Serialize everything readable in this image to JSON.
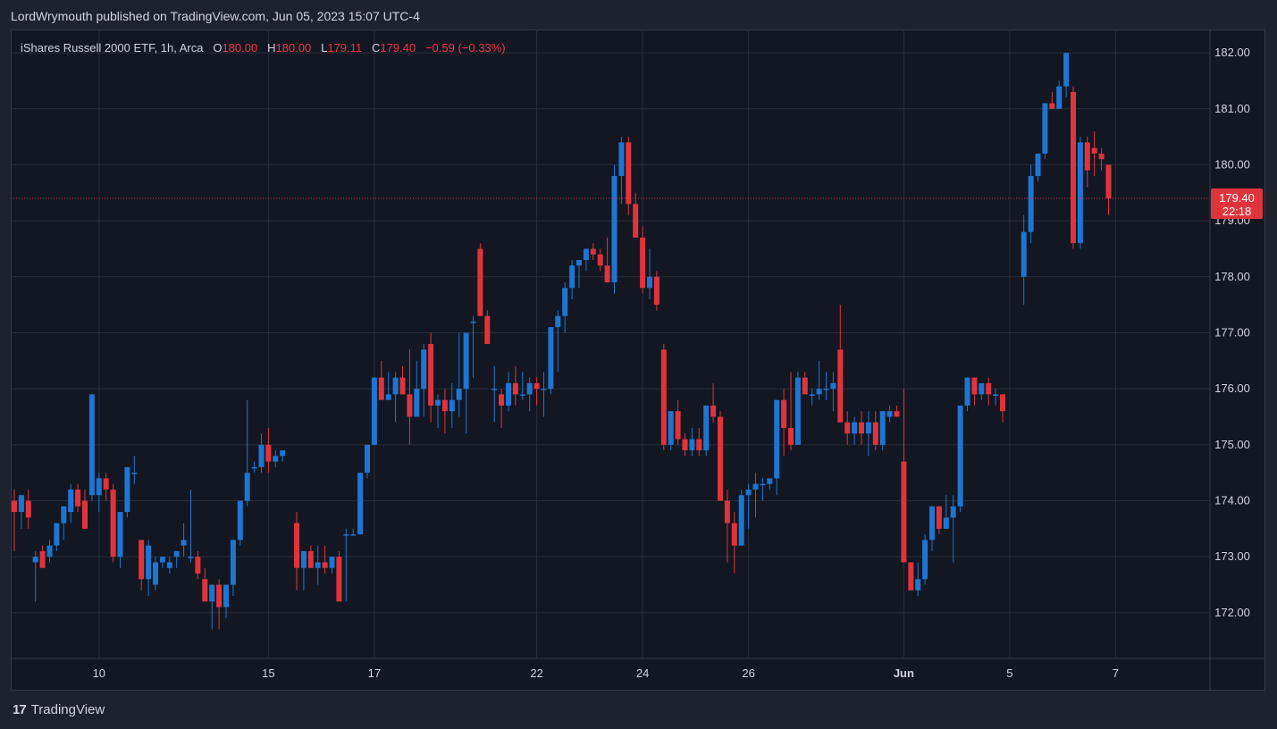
{
  "header": {
    "published_line": "LordWrymouth published on TradingView.com, Jun 05, 2023 15:07 UTC-4"
  },
  "legend": {
    "instrument": "iShares Russell 2000 ETF, 1h, Arca",
    "open_label": "O",
    "open": "180.00",
    "high_label": "H",
    "high": "180.00",
    "low_label": "L",
    "low": "179.11",
    "close_label": "C",
    "close": "179.40",
    "change": "−0.59 (−0.33%)"
  },
  "price_tag": {
    "price": "179.40",
    "countdown": "22:18"
  },
  "footer": {
    "logo_mark": "17",
    "brand": "TradingView"
  },
  "colors": {
    "up": "#2962ff",
    "up_draw": "#1e76d2",
    "down": "#e0343c",
    "background": "#1e222d",
    "pane": "#131722",
    "grid": "#2a2e39",
    "text": "#d1d4dc"
  },
  "chart_data": {
    "type": "candlestick",
    "title": "iShares Russell 2000 ETF, 1h, Arca",
    "ylim": [
      171.2,
      182.4
    ],
    "y_ticks": [
      172,
      173,
      174,
      175,
      176,
      177,
      178,
      179,
      180,
      181,
      182
    ],
    "x_ticks": [
      {
        "label": "10",
        "index": 12
      },
      {
        "label": "15",
        "index": 36
      },
      {
        "label": "17",
        "index": 51
      },
      {
        "label": "22",
        "index": 74
      },
      {
        "label": "24",
        "index": 89
      },
      {
        "label": "26",
        "index": 104
      },
      {
        "label": "Jun",
        "index": 126,
        "bold": true
      },
      {
        "label": "5",
        "index": 141
      },
      {
        "label": "7",
        "index": 156
      }
    ],
    "last_price": 179.4,
    "candles": [
      [
        174.0,
        174.2,
        173.1,
        173.8
      ],
      [
        173.8,
        174.1,
        173.5,
        174.1
      ],
      [
        174.0,
        174.2,
        173.5,
        173.7
      ],
      [
        172.9,
        173.1,
        172.2,
        173.0
      ],
      [
        173.1,
        173.2,
        172.8,
        172.8
      ],
      [
        173.0,
        173.3,
        172.9,
        173.2
      ],
      [
        173.2,
        173.6,
        173.1,
        173.6
      ],
      [
        173.6,
        173.9,
        173.3,
        173.9
      ],
      [
        173.8,
        174.3,
        173.6,
        174.2
      ],
      [
        174.2,
        174.3,
        173.8,
        173.9
      ],
      [
        174.0,
        174.2,
        173.5,
        173.5
      ],
      [
        174.1,
        175.9,
        174.0,
        175.9
      ],
      [
        174.1,
        174.5,
        173.8,
        174.4
      ],
      [
        174.4,
        174.5,
        174.0,
        174.2
      ],
      [
        174.2,
        174.3,
        172.9,
        173.0
      ],
      [
        173.0,
        173.8,
        172.8,
        173.8
      ],
      [
        173.8,
        174.6,
        173.7,
        174.6
      ],
      [
        174.5,
        174.8,
        174.3,
        174.5
      ],
      [
        173.3,
        173.3,
        172.4,
        172.6
      ],
      [
        172.6,
        173.3,
        172.3,
        173.2
      ],
      [
        172.5,
        173.0,
        172.4,
        172.9
      ],
      [
        172.9,
        173.0,
        172.8,
        173.0
      ],
      [
        172.8,
        173.0,
        172.7,
        172.9
      ],
      [
        173.0,
        173.1,
        172.8,
        173.1
      ],
      [
        173.2,
        173.6,
        173.0,
        173.3
      ],
      [
        173.0,
        174.2,
        172.9,
        173.0
      ],
      [
        173.0,
        173.1,
        172.6,
        172.7
      ],
      [
        172.6,
        172.8,
        172.2,
        172.2
      ],
      [
        172.2,
        172.5,
        171.7,
        172.5
      ],
      [
        172.5,
        172.6,
        171.7,
        172.1
      ],
      [
        172.1,
        172.5,
        171.9,
        172.5
      ],
      [
        172.5,
        173.3,
        172.3,
        173.3
      ],
      [
        173.3,
        174.0,
        173.2,
        174.0
      ],
      [
        174.0,
        175.8,
        173.9,
        174.5
      ],
      [
        174.6,
        174.7,
        174.5,
        174.6
      ],
      [
        174.6,
        175.2,
        174.5,
        175.0
      ],
      [
        175.0,
        175.3,
        174.5,
        174.7
      ],
      [
        174.7,
        174.9,
        174.6,
        174.8
      ],
      [
        174.8,
        174.9,
        174.7,
        174.9
      ],
      [
        null,
        null,
        null,
        null
      ],
      [
        173.6,
        173.8,
        172.4,
        172.8
      ],
      [
        172.8,
        173.1,
        172.4,
        173.1
      ],
      [
        173.1,
        173.2,
        172.8,
        172.8
      ],
      [
        172.8,
        173.2,
        172.5,
        172.9
      ],
      [
        172.9,
        173.2,
        172.7,
        172.8
      ],
      [
        172.8,
        172.9,
        172.7,
        173.0
      ],
      [
        173.0,
        173.1,
        172.2,
        172.2
      ],
      [
        173.4,
        173.5,
        172.2,
        173.4
      ],
      [
        173.4,
        173.5,
        173.4,
        173.4
      ],
      [
        173.4,
        174.5,
        173.4,
        174.5
      ],
      [
        174.5,
        174.9,
        174.4,
        175.0
      ],
      [
        175.0,
        176.2,
        175.0,
        176.2
      ],
      [
        176.2,
        176.5,
        175.8,
        175.8
      ],
      [
        175.8,
        176.3,
        175.9,
        175.9
      ],
      [
        175.9,
        176.3,
        175.4,
        176.2
      ],
      [
        176.2,
        176.4,
        175.9,
        175.9
      ],
      [
        175.9,
        176.7,
        175.0,
        175.5
      ],
      [
        175.5,
        176.5,
        175.5,
        176.0
      ],
      [
        176.0,
        176.8,
        175.5,
        176.7
      ],
      [
        176.8,
        177.0,
        175.4,
        175.7
      ],
      [
        175.7,
        175.9,
        175.3,
        175.8
      ],
      [
        175.8,
        176.0,
        175.2,
        175.6
      ],
      [
        175.6,
        176.1,
        175.3,
        175.8
      ],
      [
        175.8,
        177.0,
        175.5,
        176.0
      ],
      [
        176.0,
        177.0,
        175.2,
        177.0
      ],
      [
        177.2,
        177.3,
        176.2,
        177.2
      ],
      [
        178.5,
        178.6,
        177.3,
        177.3
      ],
      [
        177.3,
        177.4,
        176.8,
        176.8
      ],
      [
        176.0,
        176.4,
        175.4,
        176.0
      ],
      [
        175.9,
        176.0,
        175.3,
        175.7
      ],
      [
        175.7,
        176.3,
        175.6,
        176.1
      ],
      [
        176.1,
        176.4,
        175.7,
        175.9
      ],
      [
        175.9,
        176.3,
        175.8,
        175.9
      ],
      [
        175.9,
        176.2,
        175.6,
        176.1
      ],
      [
        176.1,
        176.2,
        175.7,
        176.0
      ],
      [
        176.0,
        176.3,
        175.5,
        176.0
      ],
      [
        176.0,
        177.1,
        175.9,
        177.1
      ],
      [
        177.1,
        177.4,
        176.3,
        177.3
      ],
      [
        177.3,
        177.9,
        177.0,
        177.8
      ],
      [
        177.8,
        178.3,
        177.6,
        178.2
      ],
      [
        178.2,
        178.3,
        177.8,
        178.3
      ],
      [
        178.3,
        178.5,
        178.1,
        178.5
      ],
      [
        178.5,
        178.6,
        178.3,
        178.4
      ],
      [
        178.4,
        178.5,
        178.1,
        178.2
      ],
      [
        178.2,
        178.7,
        178.0,
        177.9
      ],
      [
        177.9,
        180.0,
        177.7,
        179.8
      ],
      [
        179.8,
        180.5,
        179.3,
        180.4
      ],
      [
        180.4,
        180.5,
        179.1,
        179.3
      ],
      [
        179.3,
        179.5,
        178.7,
        178.7
      ],
      [
        178.7,
        178.9,
        177.7,
        177.8
      ],
      [
        177.8,
        178.5,
        177.6,
        178.0
      ],
      [
        178.0,
        178.1,
        177.4,
        177.5
      ],
      [
        176.7,
        176.8,
        174.9,
        175.0
      ],
      [
        175.0,
        175.6,
        174.9,
        175.6
      ],
      [
        175.6,
        175.8,
        175.0,
        175.1
      ],
      [
        175.1,
        175.2,
        174.8,
        174.9
      ],
      [
        174.9,
        175.3,
        174.8,
        175.1
      ],
      [
        175.1,
        175.3,
        174.8,
        174.9
      ],
      [
        174.9,
        175.7,
        174.8,
        175.7
      ],
      [
        175.7,
        176.1,
        175.4,
        175.5
      ],
      [
        175.5,
        175.6,
        174.0,
        174.0
      ],
      [
        174.0,
        174.2,
        172.9,
        173.6
      ],
      [
        173.6,
        173.8,
        172.7,
        173.2
      ],
      [
        173.2,
        174.2,
        173.2,
        174.1
      ],
      [
        174.1,
        174.3,
        173.5,
        174.2
      ],
      [
        174.2,
        174.5,
        173.7,
        174.3
      ],
      [
        174.3,
        174.4,
        174.0,
        174.3
      ],
      [
        174.3,
        174.4,
        174.2,
        174.4
      ],
      [
        174.4,
        175.8,
        174.1,
        175.8
      ],
      [
        175.8,
        176.0,
        174.8,
        175.3
      ],
      [
        175.3,
        176.3,
        174.9,
        175.0
      ],
      [
        175.0,
        176.3,
        175.0,
        176.2
      ],
      [
        176.2,
        176.3,
        175.9,
        175.9
      ],
      [
        175.9,
        176.0,
        175.7,
        175.9
      ],
      [
        175.9,
        176.5,
        175.8,
        176.0
      ],
      [
        176.0,
        176.3,
        175.8,
        176.0
      ],
      [
        176.0,
        176.3,
        175.6,
        176.1
      ],
      [
        176.7,
        177.5,
        175.5,
        175.4
      ],
      [
        175.4,
        175.6,
        175.0,
        175.2
      ],
      [
        175.2,
        175.5,
        175.0,
        175.4
      ],
      [
        175.4,
        175.6,
        175.0,
        175.2
      ],
      [
        175.2,
        175.6,
        174.8,
        175.4
      ],
      [
        175.4,
        175.6,
        174.9,
        175.0
      ],
      [
        175.0,
        175.6,
        174.9,
        175.6
      ],
      [
        175.5,
        175.7,
        175.4,
        175.6
      ],
      [
        175.6,
        175.7,
        175.5,
        175.5
      ],
      [
        174.7,
        176.0,
        172.9,
        172.9
      ],
      [
        172.9,
        172.9,
        172.4,
        172.4
      ],
      [
        172.4,
        172.9,
        172.3,
        172.6
      ],
      [
        172.6,
        173.4,
        172.5,
        173.3
      ],
      [
        173.3,
        173.9,
        173.1,
        173.9
      ],
      [
        173.9,
        173.9,
        173.4,
        173.5
      ],
      [
        173.5,
        174.1,
        173.5,
        173.7
      ],
      [
        173.7,
        174.1,
        172.9,
        173.9
      ],
      [
        173.9,
        175.7,
        173.8,
        175.7
      ],
      [
        175.7,
        176.2,
        175.6,
        176.2
      ],
      [
        176.2,
        176.2,
        175.7,
        175.9
      ],
      [
        175.9,
        176.1,
        175.8,
        176.1
      ],
      [
        176.1,
        176.2,
        175.7,
        175.9
      ],
      [
        175.9,
        176.0,
        175.7,
        175.9
      ],
      [
        175.9,
        175.8,
        175.4,
        175.6
      ],
      [
        null,
        null,
        null,
        null
      ],
      [
        null,
        null,
        null,
        null
      ],
      [
        178.0,
        179.1,
        177.5,
        178.8
      ],
      [
        178.8,
        180.0,
        178.6,
        179.8
      ],
      [
        179.8,
        180.2,
        179.7,
        180.2
      ],
      [
        180.2,
        181.1,
        180.1,
        181.1
      ],
      [
        181.1,
        181.3,
        181.0,
        181.0
      ],
      [
        181.0,
        181.5,
        181.2,
        181.4
      ],
      [
        181.4,
        182.0,
        181.2,
        182.0
      ],
      [
        181.3,
        181.4,
        178.5,
        178.6
      ],
      [
        178.6,
        180.5,
        178.5,
        180.4
      ],
      [
        180.4,
        180.5,
        179.6,
        179.9
      ],
      [
        180.3,
        180.6,
        179.8,
        180.2
      ],
      [
        180.2,
        180.3,
        179.9,
        180.1
      ],
      [
        180.0,
        180.0,
        179.1,
        179.4
      ]
    ]
  }
}
